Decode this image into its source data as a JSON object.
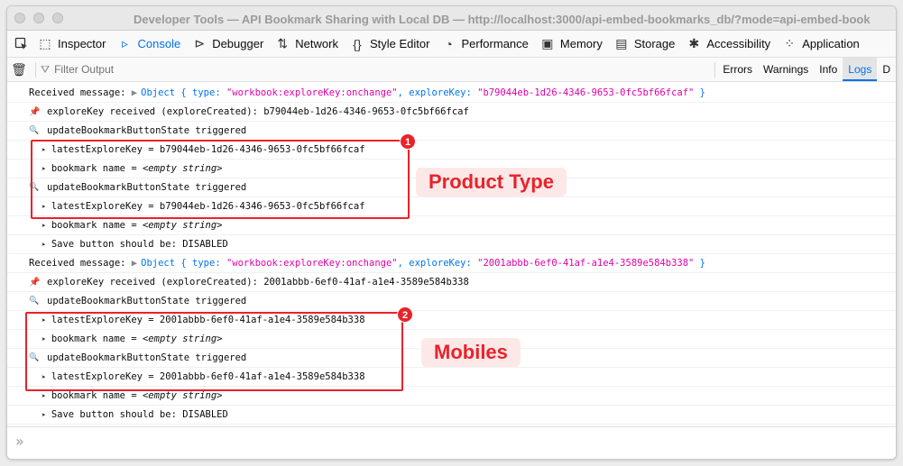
{
  "window": {
    "title": "Developer Tools — API Bookmark Sharing with Local DB — http://localhost:3000/api-embed-bookmarks_db/?mode=api-embed-book"
  },
  "toolbar": {
    "tabs": [
      {
        "label": "Inspector",
        "icon": "inspector-icon"
      },
      {
        "label": "Console",
        "icon": "console-icon",
        "selected": true
      },
      {
        "label": "Debugger",
        "icon": "debugger-icon"
      },
      {
        "label": "Network",
        "icon": "network-icon"
      },
      {
        "label": "Style Editor",
        "icon": "style-editor-icon"
      },
      {
        "label": "Performance",
        "icon": "performance-icon"
      },
      {
        "label": "Memory",
        "icon": "memory-icon"
      },
      {
        "label": "Storage",
        "icon": "storage-icon"
      },
      {
        "label": "Accessibility",
        "icon": "accessibility-icon"
      },
      {
        "label": "Application",
        "icon": "application-icon"
      }
    ]
  },
  "filterbar": {
    "placeholder": "Filter Output",
    "levels": [
      "Errors",
      "Warnings",
      "Info",
      "Logs",
      "D"
    ],
    "active_level": "Logs"
  },
  "console": {
    "rows": [
      {
        "type": "object",
        "prefix": "Received message:",
        "obj_label": "Object",
        "obj_open": "{ type: ",
        "type_val": "\"workbook:exploreKey:onchange\"",
        "key_label": ", exploreKey: ",
        "key_val": "\"b79044eb-1d26-4346-9653-0fc5bf66fcaf\"",
        "obj_close": " }"
      },
      {
        "type": "pin",
        "text": "exploreKey received (exploreCreated): b79044eb-1d26-4346-9653-0fc5bf66fcaf"
      },
      {
        "type": "search",
        "text": "updateBookmarkButtonState triggered"
      },
      {
        "type": "arrow",
        "text": "latestExploreKey = b79044eb-1d26-4346-9653-0fc5bf66fcaf"
      },
      {
        "type": "arrow",
        "text": "bookmark name = ",
        "em": "<empty string>"
      },
      {
        "type": "search2",
        "text": "updateBookmarkButtonState triggered"
      },
      {
        "type": "arrow",
        "text": "latestExploreKey = b79044eb-1d26-4346-9653-0fc5bf66fcaf"
      },
      {
        "type": "arrow",
        "text": "bookmark name = ",
        "em": "<empty string>"
      },
      {
        "type": "arrow",
        "text": "Save button should be: DISABLED"
      },
      {
        "type": "object",
        "prefix": "Received message:",
        "obj_label": "Object",
        "obj_open": "{ type: ",
        "type_val": "\"workbook:exploreKey:onchange\"",
        "key_label": ", exploreKey: ",
        "key_val": "\"2001abbb-6ef0-41af-a1e4-3589e584b338\"",
        "obj_close": " }"
      },
      {
        "type": "pin",
        "text": "exploreKey received (exploreCreated): 2001abbb-6ef0-41af-a1e4-3589e584b338"
      },
      {
        "type": "search",
        "text": "updateBookmarkButtonState triggered"
      },
      {
        "type": "arrow",
        "text": "latestExploreKey = 2001abbb-6ef0-41af-a1e4-3589e584b338"
      },
      {
        "type": "arrow",
        "text": "bookmark name = ",
        "em": "<empty string>"
      },
      {
        "type": "search2",
        "text": "updateBookmarkButtonState triggered"
      },
      {
        "type": "arrow",
        "text": "latestExploreKey = 2001abbb-6ef0-41af-a1e4-3589e584b338"
      },
      {
        "type": "arrow",
        "text": "bookmark name = ",
        "em": "<empty string>"
      },
      {
        "type": "arrow",
        "text": "Save button should be: DISABLED"
      }
    ]
  },
  "annotations": {
    "badge1": "1",
    "badge2": "2",
    "callout1": "Product Type",
    "callout2": "Mobiles",
    "color": "#e8232a"
  },
  "prompt": {
    "icon": "chevron-double-right-icon"
  }
}
